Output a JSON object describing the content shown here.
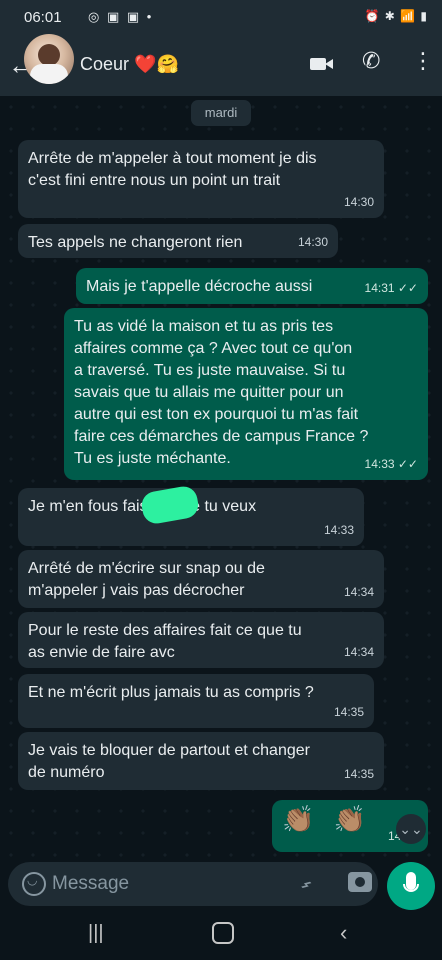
{
  "status_bar": {
    "time": "06:01",
    "indicators": "◎ ▣ ▣ •",
    "right": "⏰ ✱ 📶 ▮"
  },
  "header": {
    "back_icon": "←",
    "contact_name": "Coeur ❤️🤗"
  },
  "day_chip": "mardi",
  "messages": [
    {
      "dir": "in",
      "text": "Arrête de m'appeler à tout moment je dis\nc'est fini entre  nous un point un trait",
      "time": "14:30"
    },
    {
      "dir": "in",
      "text": "Tes appels ne changeront rien",
      "time": "14:30"
    },
    {
      "dir": "out",
      "text": "Mais je t'appelle décroche aussi",
      "time": "14:31 ✓✓"
    },
    {
      "dir": "out",
      "text": "Tu as vidé la maison et tu as pris tes\naffaires comme ça ? Avec tout ce qu'on\na traversé. Tu es juste mauvaise. Si tu\nsavais que tu allais me quitter pour un\nautre qui est ton ex pourquoi tu m'as fait\nfaire ces démarches de campus France ?\nTu es juste méchante.",
      "time": "14:33 ✓✓"
    },
    {
      "dir": "in",
      "text": "Je m'en fous         fais ce que tu veux",
      "time": "14:33"
    },
    {
      "dir": "in",
      "text": "Arrêté de m'écrire sur snap ou de\nm'appeler j vais pas décrocher",
      "time": "14:34"
    },
    {
      "dir": "in",
      "text": "Pour le reste des affaires fait ce que tu\nas envie de faire avc",
      "time": "14:34"
    },
    {
      "dir": "in",
      "text": "Et ne m'écrit plus jamais tu as compris ?",
      "time": "14:35"
    },
    {
      "dir": "in",
      "text": "Je vais te bloquer de partout et changer\nde numéro",
      "time": "14:35"
    },
    {
      "dir": "out",
      "text": "👏🏽 👏🏽",
      "time": "14:36"
    }
  ],
  "scroll_down": "⌄⌄",
  "input": {
    "placeholder": "Message"
  },
  "nav": {
    "recents": "|||",
    "back": "‹"
  }
}
